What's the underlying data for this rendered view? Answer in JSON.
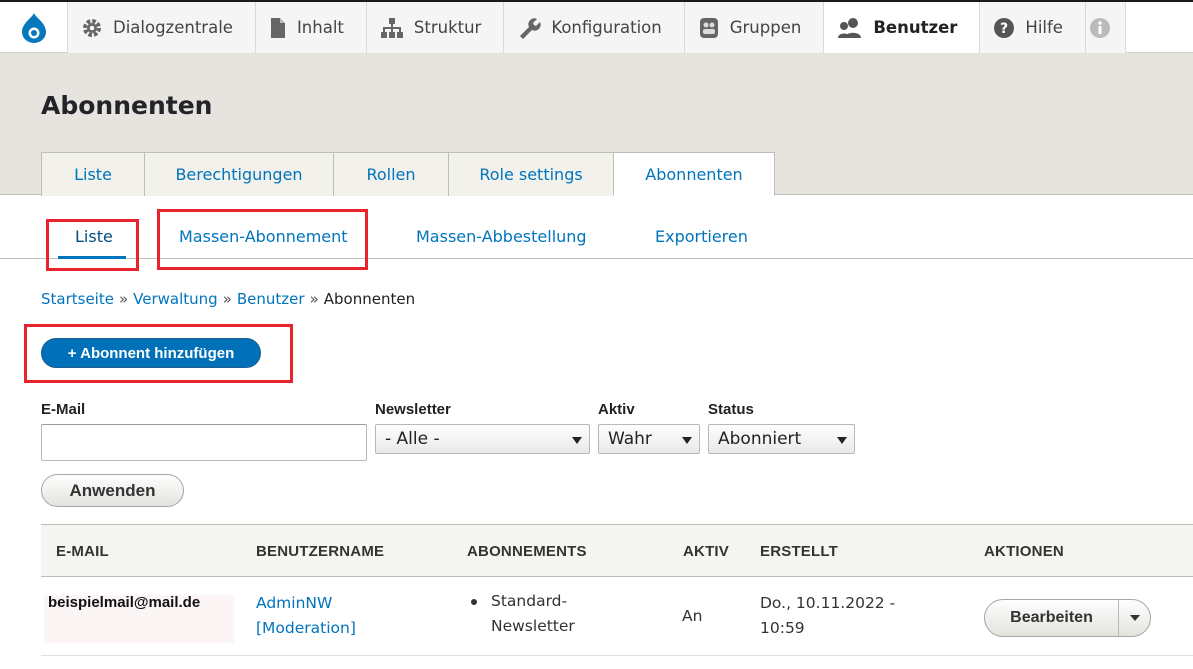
{
  "toolbar": {
    "items": [
      {
        "label": "Dialogzentrale",
        "icon": "gear-icon"
      },
      {
        "label": "Inhalt",
        "icon": "file-icon"
      },
      {
        "label": "Struktur",
        "icon": "sitemap-icon"
      },
      {
        "label": "Konfiguration",
        "icon": "wrench-icon"
      },
      {
        "label": "Gruppen",
        "icon": "groups-icon"
      },
      {
        "label": "Benutzer",
        "icon": "people-icon"
      },
      {
        "label": "Hilfe",
        "icon": "help-icon"
      }
    ],
    "active": "Benutzer"
  },
  "page": {
    "title": "Abonnenten"
  },
  "primary_tabs": [
    "Liste",
    "Berechtigungen",
    "Rollen",
    "Role settings",
    "Abonnenten"
  ],
  "secondary_tabs": [
    "Liste",
    "Massen-Abonnement",
    "Massen-Abbestellung",
    "Exportieren"
  ],
  "breadcrumb": {
    "links": [
      "Startseite",
      "Verwaltung",
      "Benutzer"
    ],
    "current": "Abonnenten",
    "separator": "»"
  },
  "add_button": "+ Abonnent hinzufügen",
  "filters": {
    "email_label": "E-Mail",
    "email_value": "",
    "newsletter_label": "Newsletter",
    "newsletter_value": "- Alle -",
    "aktiv_label": "Aktiv",
    "aktiv_value": "Wahr",
    "status_label": "Status",
    "status_value": "Abonniert",
    "apply": "Anwenden"
  },
  "table": {
    "headers": [
      "E-MAIL",
      "BENUTZERNAME",
      "ABONNEMENTS",
      "AKTIV",
      "ERSTELLT",
      "AKTIONEN"
    ],
    "rows": [
      {
        "email": "beispielmail@mail.de",
        "username_line1": "AdminNW",
        "username_line2": "[Moderation]",
        "subscription_line1": "Standard-",
        "subscription_line2": "Newsletter",
        "aktiv": "An",
        "created_line1": "Do., 10.11.2022 -",
        "created_line2": "10:59",
        "action": "Bearbeiten"
      }
    ]
  },
  "colors": {
    "link": "#0074bd",
    "primary_button": "#0071b8",
    "highlight": "#e8232d",
    "header_bg": "#e7e4df"
  }
}
